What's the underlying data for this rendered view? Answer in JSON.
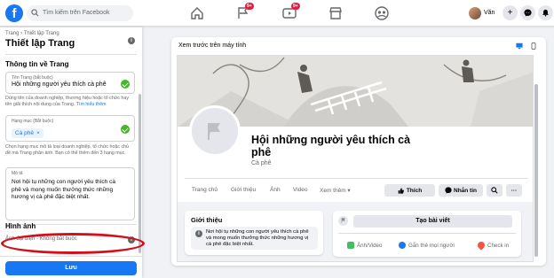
{
  "topbar": {
    "logo": "f",
    "search_placeholder": "Tìm kiếm trên Facebook",
    "badges": {
      "pages": "9+",
      "watch": "9+"
    },
    "profile_name": "Văn",
    "icons": [
      "home-icon",
      "flag-icon",
      "video-icon",
      "marketplace-icon",
      "groups-icon",
      "plus-icon",
      "messenger-icon",
      "bell-icon"
    ]
  },
  "left": {
    "breadcrumb": "Trang › Thiết lập Trang",
    "title": "Thiết lập Trang",
    "section_info": "Thông tin về Trang",
    "name_field": {
      "label": "Tên Trang (bắt buộc)",
      "value": "Hội những người yêu thích cà phê"
    },
    "name_help": "Dùng tên của doanh nghiệp, thương hiệu hoặc tổ chức hay tên giải thích nội dung của Trang.",
    "name_help_link": "Tìm hiểu thêm",
    "category_field": {
      "label": "Hạng mục (Bắt buộc)",
      "tag": "Cà phê",
      "tag_remove": "×"
    },
    "category_help": "Chọn hạng mục mô tả loại doanh nghiệp, tổ chức hoặc chủ đề mà Trang phản ánh. Bạn có thể thêm đến 3 hạng mục.",
    "bio_field": {
      "label": "Mô tả",
      "value": "Nơi hội tụ những con người yêu thích cà phê và mong muốn thưởng thức những hương vị cà phê đặc biệt nhất."
    },
    "section_images": "Hình ảnh",
    "profile_pic_label": "Ảnh đại diện · Không bắt buộc",
    "save_label": "Lưu"
  },
  "preview": {
    "title": "Xem trước trên máy tính",
    "page_name": "Hội những người yêu thích cà phê",
    "category": "Cà phê",
    "tabs": [
      "Trang chủ",
      "Giới thiệu",
      "Ảnh",
      "Video",
      "Xem thêm ▾"
    ],
    "like_label": "Thích",
    "message_label": "Nhắn tin",
    "intro_title": "Giới thiệu",
    "intro_text": "Nơi hội tụ những con người yêu thích cà phê và mong muốn thưởng thức những hương vị cà phê đặc biệt nhất.",
    "create_post": "Tạo bài viết",
    "actions": [
      "Ảnh/Video",
      "Gắn thẻ mọi người",
      "Check in"
    ],
    "more": "···"
  },
  "colors": {
    "brand": "#1877f2",
    "badge": "#e41e3f",
    "check": "#42b72a",
    "highlight_ring": "#d3101a"
  }
}
